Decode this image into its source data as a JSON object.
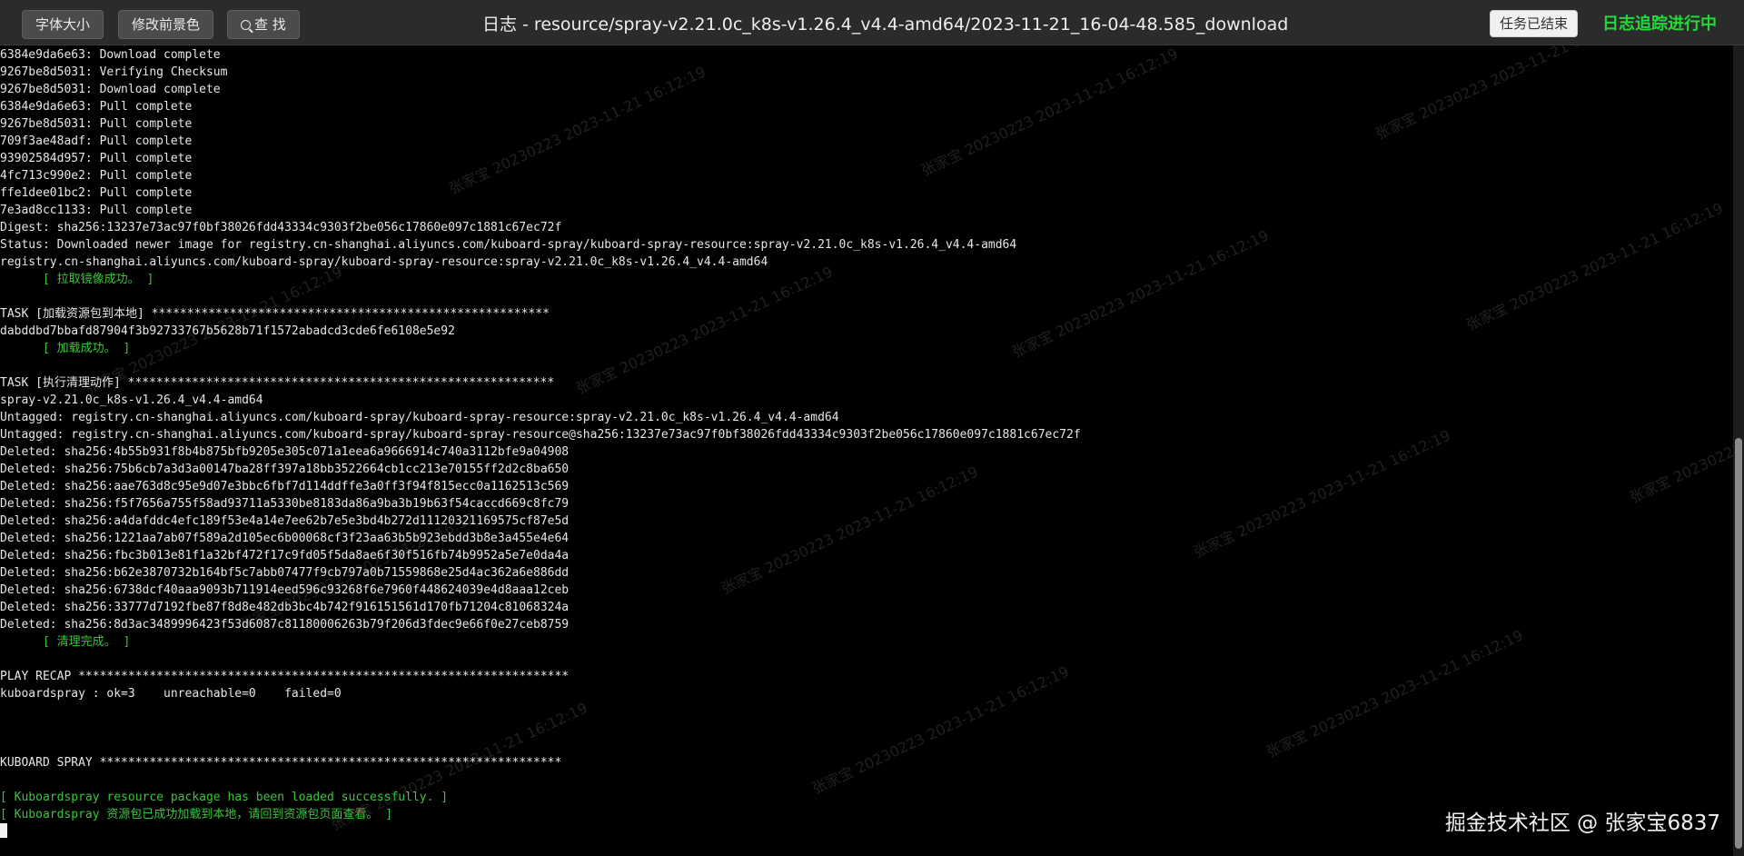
{
  "toolbar": {
    "font_size_label": "字体大小",
    "bg_color_label": "修改前景色",
    "search_label": "查 找"
  },
  "title": "日志 - resource/spray-v2.21.0c_k8s-v1.26.4_v4.4-amd64/2023-11-21_16-04-48.585_download",
  "status_badge": "任务已结束",
  "tracking_status": "日志追踪进行中",
  "colors": {
    "background": "#000000",
    "text": "#e6e6e6",
    "success": "#3cc43c",
    "tracking": "#22d93a"
  },
  "watermark_text": "张家宝 20230223 2023-11-21 16:12:19",
  "footer_watermark": "掘金技术社区 @ 张家宝6837",
  "log": [
    {
      "text": "6384e9da6e63: Download complete",
      "type": "normal"
    },
    {
      "text": "9267be8d5031: Verifying Checksum",
      "type": "normal"
    },
    {
      "text": "9267be8d5031: Download complete",
      "type": "normal"
    },
    {
      "text": "6384e9da6e63: Pull complete",
      "type": "normal"
    },
    {
      "text": "9267be8d5031: Pull complete",
      "type": "normal"
    },
    {
      "text": "709f3ae48adf: Pull complete",
      "type": "normal"
    },
    {
      "text": "93902584d957: Pull complete",
      "type": "normal"
    },
    {
      "text": "4fc713c990e2: Pull complete",
      "type": "normal"
    },
    {
      "text": "ffe1dee01bc2: Pull complete",
      "type": "normal"
    },
    {
      "text": "7e3ad8cc1133: Pull complete",
      "type": "normal"
    },
    {
      "text": "Digest: sha256:13237e73ac97f0bf38026fdd43334c9303f2be056c17860e097c1881c67ec72f",
      "type": "normal"
    },
    {
      "text": "Status: Downloaded newer image for registry.cn-shanghai.aliyuncs.com/kuboard-spray/kuboard-spray-resource:spray-v2.21.0c_k8s-v1.26.4_v4.4-amd64",
      "type": "normal"
    },
    {
      "text": "registry.cn-shanghai.aliyuncs.com/kuboard-spray/kuboard-spray-resource:spray-v2.21.0c_k8s-v1.26.4_v4.4-amd64",
      "type": "normal"
    },
    {
      "text": "      [ 拉取镜像成功。 ]",
      "type": "ok"
    },
    {
      "text": "",
      "type": "normal"
    },
    {
      "text": "TASK [加载资源包到本地] ********************************************************",
      "type": "normal"
    },
    {
      "text": "dabddbd7bbafd87904f3b92733767b5628b71f1572abadcd3cde6fe6108e5e92",
      "type": "normal"
    },
    {
      "text": "      [ 加载成功。 ]",
      "type": "ok"
    },
    {
      "text": "",
      "type": "normal"
    },
    {
      "text": "TASK [执行清理动作] ************************************************************",
      "type": "normal"
    },
    {
      "text": "spray-v2.21.0c_k8s-v1.26.4_v4.4-amd64",
      "type": "normal"
    },
    {
      "text": "Untagged: registry.cn-shanghai.aliyuncs.com/kuboard-spray/kuboard-spray-resource:spray-v2.21.0c_k8s-v1.26.4_v4.4-amd64",
      "type": "normal"
    },
    {
      "text": "Untagged: registry.cn-shanghai.aliyuncs.com/kuboard-spray/kuboard-spray-resource@sha256:13237e73ac97f0bf38026fdd43334c9303f2be056c17860e097c1881c67ec72f",
      "type": "normal"
    },
    {
      "text": "Deleted: sha256:4b55b931f8b4b875bfb9205e305c071a1eea6a9666914c740a3112bfe9a04908",
      "type": "normal"
    },
    {
      "text": "Deleted: sha256:75b6cb7a3d3a00147ba28ff397a18bb3522664cb1cc213e70155ff2d2c8ba650",
      "type": "normal"
    },
    {
      "text": "Deleted: sha256:aae763d8c95e9d07e3bbc6fbf7d114ddffe3a0ff3f94f815ecc0a1162513c569",
      "type": "normal"
    },
    {
      "text": "Deleted: sha256:f5f7656a755f58ad93711a5330be8183da86a9ba3b19b63f54caccd669c8fc79",
      "type": "normal"
    },
    {
      "text": "Deleted: sha256:a4dafddc4efc189f53e4a14e7ee62b7e5e3bd4b272d11120321169575cf87e5d",
      "type": "normal"
    },
    {
      "text": "Deleted: sha256:1221aa7ab07f589a2d105ec6b00068cf3f23aa63b5b923ebdd3b8e3a455e4e64",
      "type": "normal"
    },
    {
      "text": "Deleted: sha256:fbc3b013e81f1a32bf472f17c9fd05f5da8ae6f30f516fb74b9952a5e7e0da4a",
      "type": "normal"
    },
    {
      "text": "Deleted: sha256:b62e3870732b164bf5c7abb07477f9cb797a0b71559868e25d4ac362a6e886dd",
      "type": "normal"
    },
    {
      "text": "Deleted: sha256:6738dcf40aaa9093b711914eed596c93268f6e7960f448624039e4d8aaa12ceb",
      "type": "normal"
    },
    {
      "text": "Deleted: sha256:33777d7192fbe87f8d8e482db3bc4b742f916151561d170fb71204c81068324a",
      "type": "normal"
    },
    {
      "text": "Deleted: sha256:8d3ac3489996423f53d6087c81180006263b79f206d3fdec9e66f0e27ceb8759",
      "type": "normal"
    },
    {
      "text": "      [ 清理完成。 ]",
      "type": "ok"
    },
    {
      "text": "",
      "type": "normal"
    },
    {
      "text": "PLAY RECAP *********************************************************************",
      "type": "normal"
    },
    {
      "text": "kuboardspray : ok=3    unreachable=0    failed=0",
      "type": "normal"
    },
    {
      "text": "",
      "type": "normal"
    },
    {
      "text": "",
      "type": "normal"
    },
    {
      "text": "",
      "type": "normal"
    },
    {
      "text": "KUBOARD SPRAY *****************************************************************",
      "type": "normal"
    },
    {
      "text": "",
      "type": "normal"
    },
    {
      "text": "[ Kuboardspray resource package has been loaded successfully. ]",
      "type": "ok"
    },
    {
      "text": "[ Kuboardspray 资源包已成功加载到本地，请回到资源包页面查看。 ]",
      "type": "ok"
    }
  ]
}
